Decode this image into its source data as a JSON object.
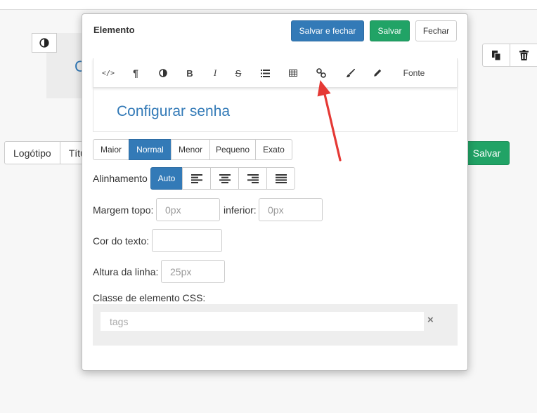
{
  "background": {
    "tabs": [
      "Logótipo",
      "Títu"
    ],
    "save_label": "Salvar",
    "preview_letter": "C",
    "actions": [
      {
        "icon": "copy-icon"
      },
      {
        "icon": "trash-icon"
      }
    ]
  },
  "modal": {
    "title": "Elemento",
    "buttons": {
      "save_close": "Salvar e fechar",
      "save": "Salvar",
      "close": "Fechar"
    },
    "toolbar": {
      "items": [
        {
          "icon": "code-icon",
          "glyph": "</>"
        },
        {
          "icon": "paragraph-icon",
          "glyph": "¶"
        },
        {
          "icon": "contrast-icon",
          "glyph": ""
        },
        {
          "icon": "bold-icon",
          "glyph": "B"
        },
        {
          "icon": "italic-icon",
          "glyph": "I"
        },
        {
          "icon": "strikethrough-icon",
          "glyph": "S"
        },
        {
          "icon": "list-icon",
          "glyph": ""
        },
        {
          "icon": "table-icon",
          "glyph": ""
        },
        {
          "icon": "link-icon",
          "glyph": ""
        },
        {
          "icon": "brush-icon",
          "glyph": ""
        },
        {
          "icon": "pencil-icon",
          "glyph": ""
        }
      ],
      "font_label": "Fonte"
    },
    "editor_text": "Configurar senha",
    "size_options": [
      "Maior",
      "Normal",
      "Menor",
      "Pequeno",
      "Exato"
    ],
    "size_selected": "Normal",
    "alignment": {
      "label": "Alinhamento",
      "auto_label": "Auto",
      "options": [
        "align-left-icon",
        "align-center-icon",
        "align-right-icon",
        "align-justify-icon"
      ]
    },
    "margin": {
      "top_label": "Margem topo:",
      "top_placeholder": "0px",
      "bottom_label": "inferior:",
      "bottom_placeholder": "0px"
    },
    "text_color": {
      "label": "Cor do texto:",
      "value": ""
    },
    "line_height": {
      "label": "Altura da linha:",
      "placeholder": "25px"
    },
    "css_class": {
      "label": "Classe de elemento CSS:",
      "placeholder": "tags",
      "clear": "×"
    }
  },
  "colors": {
    "primary": "#337ab7",
    "success": "#21a366",
    "annotation_arrow": "#e53935"
  }
}
